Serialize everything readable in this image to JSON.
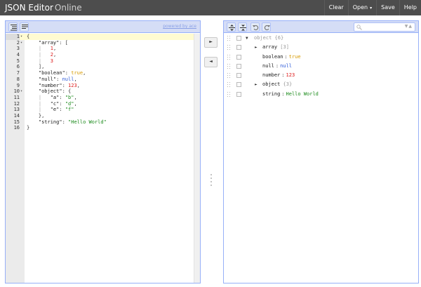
{
  "app": {
    "title_main": "JSON Editor",
    "title_suffix": "Online"
  },
  "menu": {
    "clear": "Clear",
    "open": "Open",
    "open_caret": "▾",
    "save": "Save",
    "help": "Help"
  },
  "left": {
    "powered_by": "powered by ace",
    "lines": [
      {
        "num": "1",
        "fold": "▾"
      },
      {
        "num": "2",
        "fold": "▾"
      },
      {
        "num": "3"
      },
      {
        "num": "4"
      },
      {
        "num": "5"
      },
      {
        "num": "6"
      },
      {
        "num": "7"
      },
      {
        "num": "8"
      },
      {
        "num": "9"
      },
      {
        "num": "10",
        "fold": "▾"
      },
      {
        "num": "11"
      },
      {
        "num": "12"
      },
      {
        "num": "13"
      },
      {
        "num": "14"
      },
      {
        "num": "15"
      },
      {
        "num": "16"
      }
    ],
    "code": {
      "l1": "{",
      "l2_key": "\"array\"",
      "l2_rest": ": [",
      "l3": "1",
      "l4": "2",
      "l5": "3",
      "l6": "],",
      "l7_key": "\"boolean\"",
      "l7_val": "true",
      "l8_key": "\"null\"",
      "l8_val": "null",
      "l9_key": "\"number\"",
      "l9_val": "123",
      "l10_key": "\"object\"",
      "l10_rest": ": {",
      "l11_key": "\"a\"",
      "l11_val": "\"b\"",
      "l12_key": "\"c\"",
      "l12_val": "\"d\"",
      "l13_key": "\"e\"",
      "l13_val": "\"f\"",
      "l14": "},",
      "l15_key": "\"string\"",
      "l15_val": "\"Hello World\"",
      "l16": "}"
    }
  },
  "middle": {
    "to_tree": "►",
    "to_code": "◄"
  },
  "tree": {
    "root": {
      "label": "object",
      "count": "{6}",
      "expanded_icon": "▼"
    },
    "array": {
      "key": "array",
      "count": "[3]",
      "collapsed_icon": "►"
    },
    "boolean": {
      "key": "boolean",
      "value": "true"
    },
    "null": {
      "key": "null",
      "value": "null"
    },
    "number": {
      "key": "number",
      "value": "123"
    },
    "object": {
      "key": "object",
      "count": "{3}",
      "collapsed_icon": "►"
    },
    "string": {
      "key": "string",
      "value": "Hello World"
    },
    "separator": ":"
  },
  "colors": {
    "topbar": "#4d4d4d",
    "panel_border": "#97b0f8",
    "toolbar": "#d5ddf6"
  }
}
